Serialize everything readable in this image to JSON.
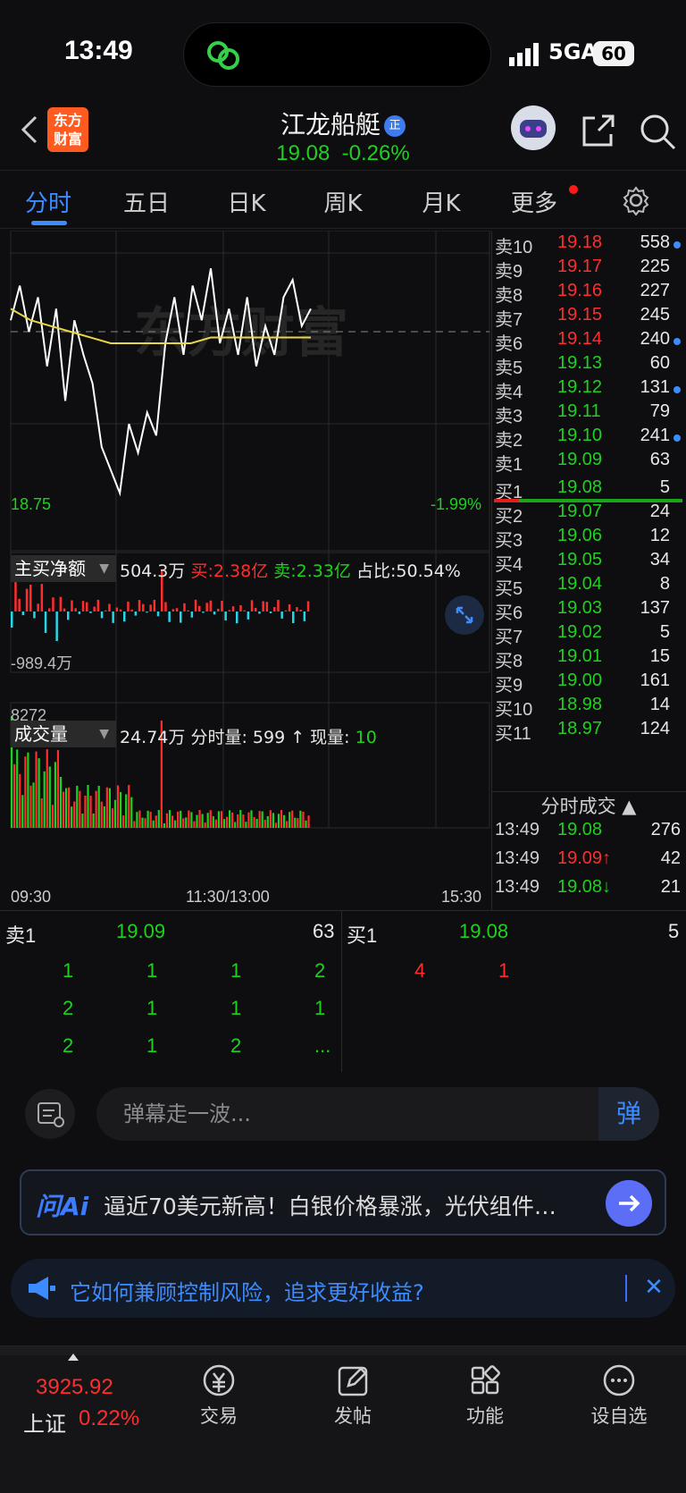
{
  "status_bar": {
    "time": "13:49",
    "network": "5GA",
    "battery": "60"
  },
  "header": {
    "logo": "东方\n财富",
    "stock_name": "江龙船艇",
    "badge": "正",
    "price": "19.08",
    "change": "-0.26%"
  },
  "tabs": [
    {
      "label": "分时"
    },
    {
      "label": "五日"
    },
    {
      "label": "日K"
    },
    {
      "label": "周K"
    },
    {
      "label": "月K"
    },
    {
      "label": "更多"
    }
  ],
  "chart": {
    "watermark": "东方财富",
    "low_price": "18.75",
    "low_pct": "-1.99%",
    "flow_label": "主买净额",
    "flow_amount": "504.3万",
    "flow_buy": "买:2.38亿",
    "flow_sell": "卖:2.33亿",
    "flow_ratio": "占比:50.54%",
    "flow_max": "989.4万",
    "flow_min": "-989.4万",
    "vol_label": "成交量",
    "vol_total": "24.74万",
    "vol_period": "分时量: 599 ↑",
    "vol_now_label": "现量:",
    "vol_now": "10",
    "vol_max": "8272",
    "time_start": "09:30",
    "time_mid": "11:30/13:00",
    "time_end": "15:30"
  },
  "chart_data": {
    "type": "line",
    "price_series": [
      19.06,
      19.12,
      19.04,
      19.1,
      18.98,
      19.08,
      18.92,
      19.06,
      19.0,
      18.95,
      18.84,
      18.8,
      18.76,
      18.88,
      18.83,
      18.9,
      18.86,
      19.02,
      19.1,
      19.0,
      19.12,
      19.06,
      19.15,
      19.02,
      19.08,
      19.0,
      19.1,
      18.98,
      19.05,
      19.0,
      19.1,
      19.13,
      19.05,
      19.08
    ],
    "avg_series": [
      19.08,
      19.06,
      19.05,
      19.04,
      19.03,
      19.02,
      19.02,
      19.02,
      19.02,
      19.02,
      19.03,
      19.03,
      19.03,
      19.03,
      19.03,
      19.03
    ]
  },
  "order_book": {
    "asks": [
      {
        "label": "卖10",
        "price": "19.18",
        "vol": "558",
        "dot": true
      },
      {
        "label": "卖9",
        "price": "19.17",
        "vol": "225",
        "dot": false
      },
      {
        "label": "卖8",
        "price": "19.16",
        "vol": "227",
        "dot": false
      },
      {
        "label": "卖7",
        "price": "19.15",
        "vol": "245",
        "dot": false
      },
      {
        "label": "卖6",
        "price": "19.14",
        "vol": "240",
        "dot": true
      },
      {
        "label": "卖5",
        "price": "19.13",
        "vol": "60",
        "dot": false
      },
      {
        "label": "卖4",
        "price": "19.12",
        "vol": "131",
        "dot": true
      },
      {
        "label": "卖3",
        "price": "19.11",
        "vol": "79",
        "dot": false
      },
      {
        "label": "卖2",
        "price": "19.10",
        "vol": "241",
        "dot": true
      },
      {
        "label": "卖1",
        "price": "19.09",
        "vol": "63",
        "dot": false
      }
    ],
    "bids": [
      {
        "label": "买1",
        "price": "19.08",
        "vol": "5"
      },
      {
        "label": "买2",
        "price": "19.07",
        "vol": "24"
      },
      {
        "label": "买3",
        "price": "19.06",
        "vol": "12"
      },
      {
        "label": "买4",
        "price": "19.05",
        "vol": "34"
      },
      {
        "label": "买5",
        "price": "19.04",
        "vol": "8"
      },
      {
        "label": "买6",
        "price": "19.03",
        "vol": "137"
      },
      {
        "label": "买7",
        "price": "19.02",
        "vol": "5"
      },
      {
        "label": "买8",
        "price": "19.01",
        "vol": "15"
      },
      {
        "label": "买9",
        "price": "19.00",
        "vol": "161"
      },
      {
        "label": "买10",
        "price": "18.98",
        "vol": "14"
      },
      {
        "label": "买11",
        "price": "18.97",
        "vol": "124"
      }
    ],
    "ticks_title": "分时成交 ▲",
    "ticks": [
      {
        "time": "13:49",
        "price": "19.08",
        "vol": "276"
      },
      {
        "time": "13:49",
        "price": "19.09↑",
        "vol": "42"
      },
      {
        "time": "13:49",
        "price": "19.08↓",
        "vol": "21"
      }
    ]
  },
  "queue": {
    "sell_label": "卖1",
    "sell_price": "19.09",
    "sell_vol": "63",
    "buy_label": "买1",
    "buy_price": "19.08",
    "buy_vol": "5",
    "sell_orders": [
      "1",
      "1",
      "1",
      "2",
      "2",
      "1",
      "1",
      "1",
      "2",
      "1",
      "2",
      "..."
    ],
    "buy_orders": [
      "4",
      "1"
    ]
  },
  "comment": {
    "placeholder": "弹幕走一波...",
    "button": "弹"
  },
  "ai": {
    "logo": "问Ai",
    "text": "逼近70美元新高！白银价格暴涨，光伏组件…"
  },
  "notice": {
    "text": "它如何兼顾控制风险，追求更好收益?"
  },
  "bottom_nav": {
    "index_value": "3925.92",
    "index_name": "上证",
    "index_pct": "0.22%",
    "items": [
      {
        "label": "交易"
      },
      {
        "label": "发帖"
      },
      {
        "label": "功能"
      },
      {
        "label": "设自选"
      }
    ]
  }
}
